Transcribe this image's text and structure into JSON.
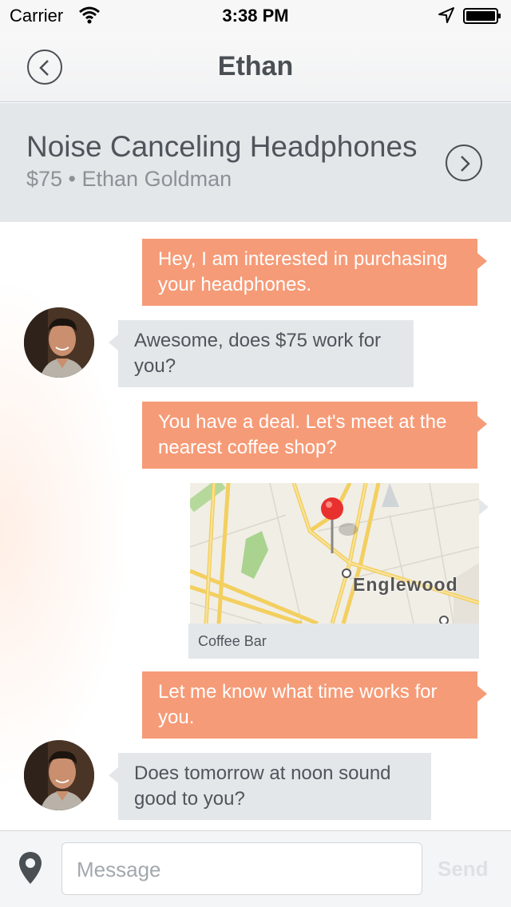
{
  "status_bar": {
    "carrier": "Carrier",
    "time": "3:38 PM"
  },
  "nav": {
    "title": "Ethan"
  },
  "listing": {
    "title": "Noise Canceling Headphones",
    "meta": "$75 • Ethan Goldman"
  },
  "messages": [
    {
      "direction": "outgoing",
      "text": "Hey, I am interested in purchasing your headphones."
    },
    {
      "direction": "incoming",
      "text": "Awesome, does $75 work for you?"
    },
    {
      "direction": "outgoing",
      "text": "You have a deal. Let's meet at the nearest coffee shop?"
    },
    {
      "direction": "outgoing",
      "type": "map",
      "place_label": "Englewood",
      "caption": "Coffee Bar"
    },
    {
      "direction": "outgoing",
      "text": "Let me know what time works for you."
    },
    {
      "direction": "incoming",
      "text": "Does tomorrow at noon sound good to you?"
    }
  ],
  "composer": {
    "placeholder": "Message",
    "send_label": "Send"
  },
  "colors": {
    "outgoing_bubble": "#f69b77",
    "incoming_bubble": "#e4e7ea",
    "text_dark": "#4a4f54"
  }
}
